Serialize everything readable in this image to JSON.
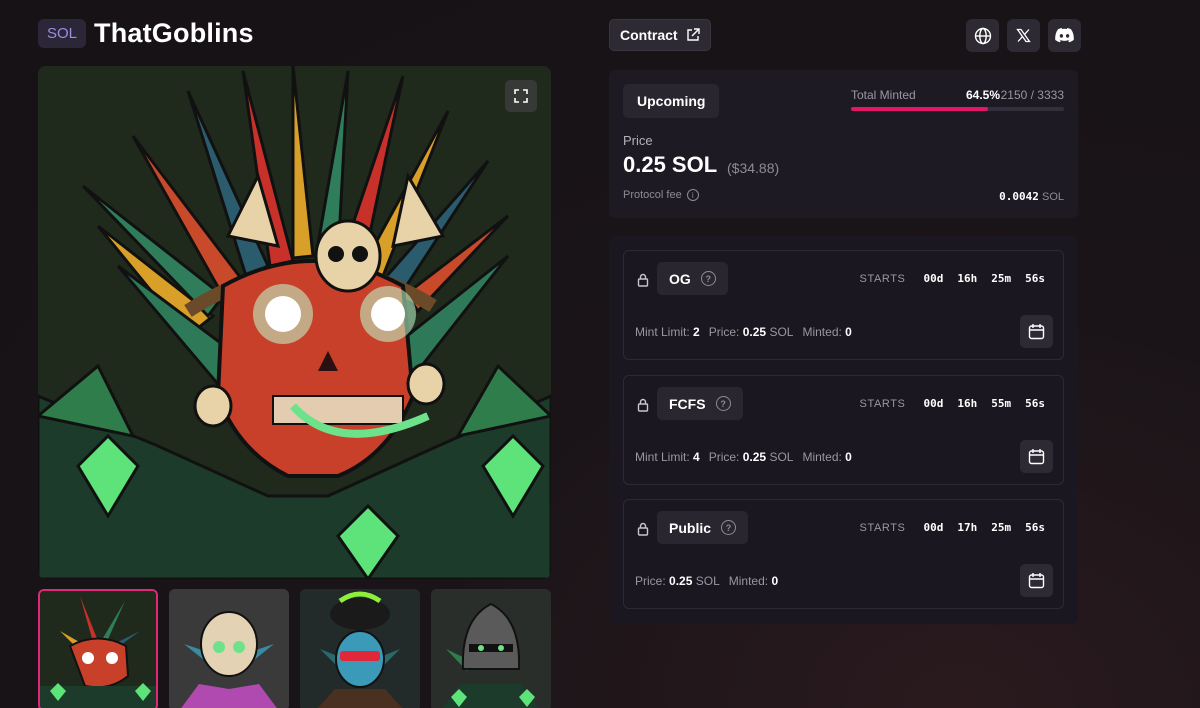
{
  "header": {
    "chain": "SOL",
    "title": "ThatGoblins"
  },
  "contract": {
    "label": "Contract"
  },
  "social": {
    "icons": [
      "globe-icon",
      "x-icon",
      "discord-icon"
    ]
  },
  "status": {
    "state": "Upcoming",
    "minted_label": "Total Minted",
    "minted_pct": "64.5%",
    "minted_count": "2150 / 3333",
    "minted_fraction": 0.645,
    "price_label": "Price",
    "price": "0.25 SOL",
    "price_usd": "($34.88)",
    "fee_label": "Protocol fee",
    "fee_value": "0.0042",
    "fee_unit": "SOL"
  },
  "phases": [
    {
      "name": "OG",
      "starts_label": "STARTS",
      "countdown": [
        "00d",
        "16h",
        "25m",
        "56s"
      ],
      "mint_limit_label": "Mint Limit:",
      "mint_limit": "2",
      "price_label": "Price:",
      "price": "0.25",
      "price_unit": "SOL",
      "minted_label": "Minted:",
      "minted": "0"
    },
    {
      "name": "FCFS",
      "starts_label": "STARTS",
      "countdown": [
        "00d",
        "16h",
        "55m",
        "56s"
      ],
      "mint_limit_label": "Mint Limit:",
      "mint_limit": "4",
      "price_label": "Price:",
      "price": "0.25",
      "price_unit": "SOL",
      "minted_label": "Minted:",
      "minted": "0"
    },
    {
      "name": "Public",
      "starts_label": "STARTS",
      "countdown": [
        "00d",
        "17h",
        "25m",
        "56s"
      ],
      "price_label": "Price:",
      "price": "0.25",
      "price_unit": "SOL",
      "minted_label": "Minted:",
      "minted": "0"
    }
  ],
  "colors": {
    "accent": "#e51668",
    "bg": "#161216",
    "card": "#1d1a24"
  }
}
